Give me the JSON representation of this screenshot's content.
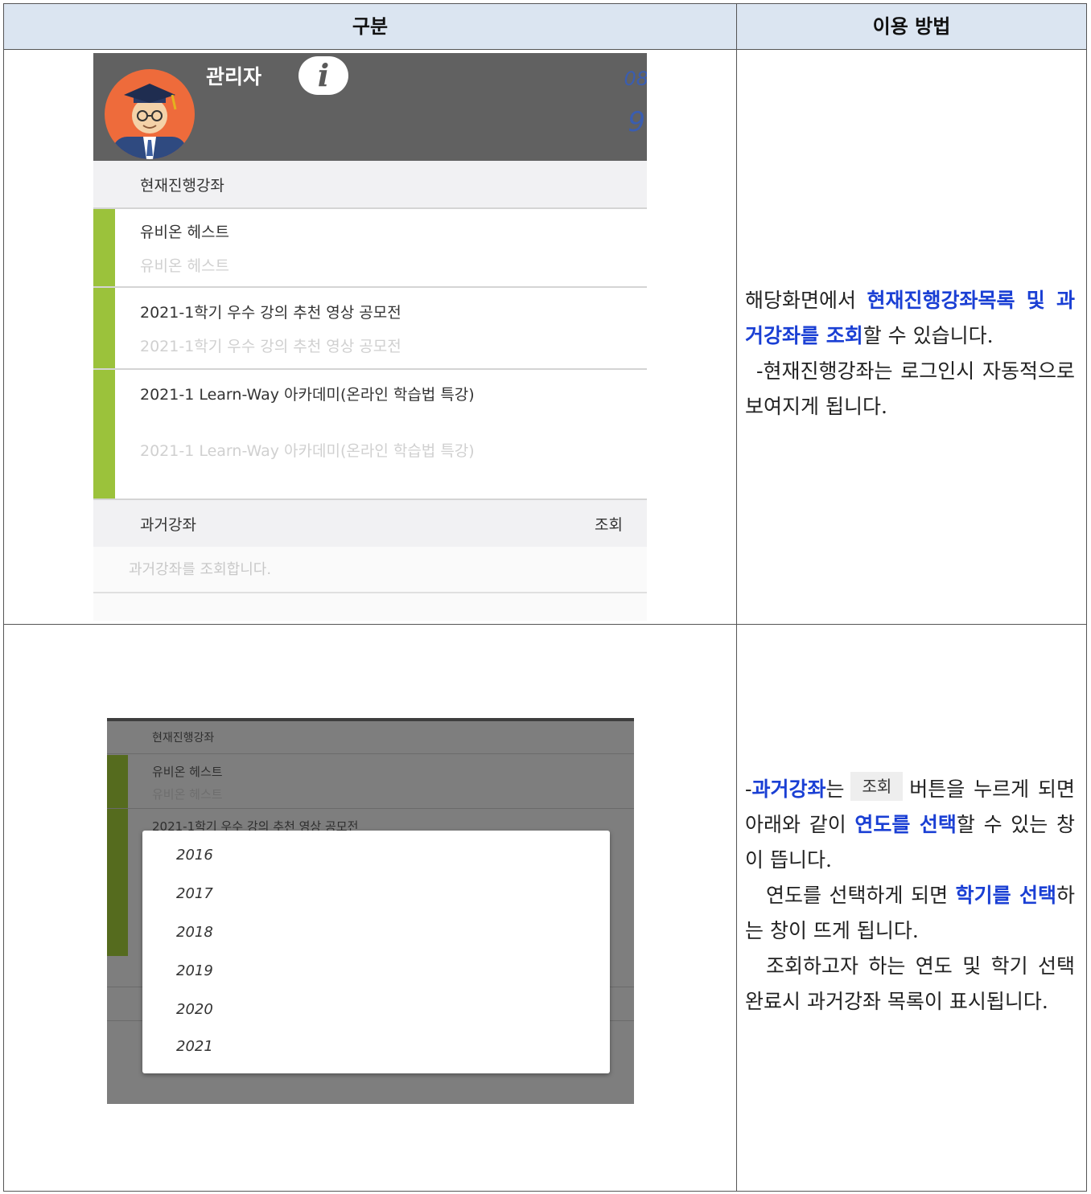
{
  "table": {
    "header": {
      "col1": "구분",
      "col2": "이용 방법"
    }
  },
  "shot1": {
    "user_name": "관리자",
    "clip_top": "08",
    "clip_bottom": "9",
    "current_section": "현재진행강좌",
    "courses": [
      {
        "title": "유비온 헤스트",
        "subtitle": "유비온 헤스트"
      },
      {
        "title": "2021-1학기 우수 강의 추천 영상 공모전",
        "subtitle": "2021-1학기 우수 강의 추천 영상 공모전"
      },
      {
        "title": "2021-1 Learn-Way 아카데미(온라인 학습법 특강)",
        "subtitle": "2021-1 Learn-Way 아카데미(온라인 학습법 특강)"
      }
    ],
    "past_section": "과거강좌",
    "past_button": "조회",
    "past_empty": "과거강좌를 조회합니다."
  },
  "shot2": {
    "current_section": "현재진행강좌",
    "course1_title": "유비온 헤스트",
    "course1_subtitle": "유비온 헤스트",
    "course2_title": "2021-1학기 우수 강의 추천 영상 공모전",
    "years": [
      "2016",
      "2017",
      "2018",
      "2019",
      "2020",
      "2021"
    ]
  },
  "desc1": {
    "p1_a": "해당화면에서 ",
    "p1_hl": "현재진행강좌목록 및 과거강좌를 조회",
    "p1_b": "할 수 있습니다.",
    "p2": "-현재진행강좌는 로그인시 자동적으로 보여지게 됩니다."
  },
  "desc2": {
    "dash": "-",
    "hl1": "과거강좌",
    "t1": "는",
    "button": "조회",
    "t2": "버튼을 누르게 되면 아래와 같이 ",
    "hl2": "연도를 선택",
    "t3": "할 수 있는 창이 뜹니다.",
    "t4": "연도를 선택하게 되면 ",
    "hl3": "학기를 선택",
    "t5": "하는 창이 뜨게 됩니다.",
    "t6": "조회하고자 하는 연도 및 학기 선택완료시 과거강좌 목록이 표시됩니다."
  },
  "colors": {
    "header_bg": "#dbe5f1",
    "highlight": "#1a3fd4",
    "course_bar": "#9bc23b"
  }
}
